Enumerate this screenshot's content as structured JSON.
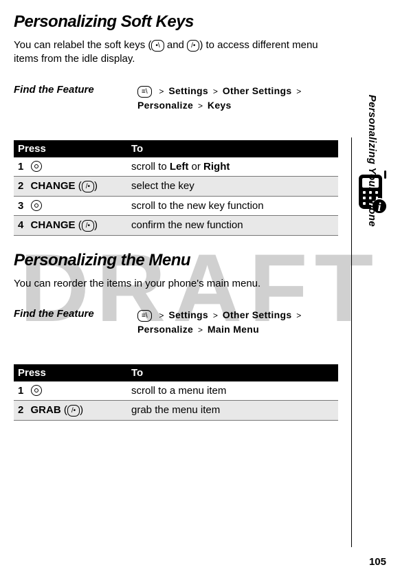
{
  "watermark": "DRAFT",
  "section1": {
    "heading": "Personalizing Soft Keys",
    "intro_pre": "You can relabel the soft keys (",
    "soft_left": "⬘",
    "intro_and": " and ",
    "soft_right": "⬙",
    "intro_post": ") to access different menu items from the idle display.",
    "feature_label": "Find the Feature",
    "menu_key": "☰",
    "sep": ">",
    "path": {
      "p1": "Settings",
      "p2": "Other Settings",
      "p3": "Personalize",
      "p4": "Keys"
    },
    "table": {
      "head_press": "Press",
      "head_to": "To",
      "rows": [
        {
          "n": "1",
          "press_type": "circle",
          "to_pre": "scroll to ",
          "to_b1": "Left",
          "to_mid": "  or ",
          "to_b2": "Right"
        },
        {
          "n": "2",
          "press_type": "fn",
          "fn": "CHANGE",
          "to": "select the key"
        },
        {
          "n": "3",
          "press_type": "circle",
          "to": "scroll to the new key function"
        },
        {
          "n": "4",
          "press_type": "fn",
          "fn": "CHANGE",
          "to": "confirm the new function"
        }
      ]
    }
  },
  "section2": {
    "heading": "Personalizing the Menu",
    "intro": "You can reorder the items in your phone's main menu.",
    "feature_label": "Find the Feature",
    "menu_key": "☰",
    "sep": ">",
    "path": {
      "p1": "Settings",
      "p2": "Other Settings",
      "p3": "Personalize",
      "p4": "Main Menu"
    },
    "table": {
      "head_press": "Press",
      "head_to": "To",
      "rows": [
        {
          "n": "1",
          "press_type": "circle",
          "to": "scroll to a menu item"
        },
        {
          "n": "2",
          "press_type": "fn",
          "fn": "GRAB",
          "to": "grab the menu item"
        }
      ]
    }
  },
  "side": {
    "label": "Personalizing Your Phone",
    "info": "i",
    "page": "105"
  }
}
